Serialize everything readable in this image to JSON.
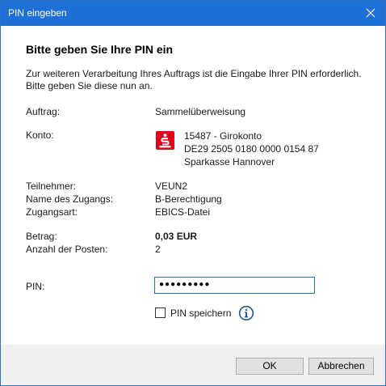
{
  "window": {
    "title": "PIN eingeben"
  },
  "heading": "Bitte geben Sie Ihre PIN ein",
  "intro": {
    "line1": "Zur weiteren Verarbeitung Ihres Auftrags ist die Eingabe Ihrer PIN erforderlich.",
    "line2": "Bitte geben Sie diese nun an."
  },
  "details": {
    "auftrag_label": "Auftrag:",
    "auftrag_value": "Sammelüberweisung",
    "konto_label": "Konto:",
    "konto_line1": "15487 - Girokonto",
    "konto_line2": "DE29 2505 0180 0000 0154 87",
    "konto_line3": "Sparkasse Hannover",
    "teilnehmer_label": "Teilnehmer:",
    "teilnehmer_value": "VEUN2",
    "zugang_label": "Name des Zugangs:",
    "zugang_value": "B-Berechtigung",
    "zugangsart_label": "Zugangsart:",
    "zugangsart_value": "EBICS-Datei",
    "betrag_label": "Betrag:",
    "betrag_value": "0,03 EUR",
    "posten_label": "Anzahl der Posten:",
    "posten_value": "2"
  },
  "pin": {
    "label": "PIN:",
    "masked_value": "●●●●●●●●●",
    "save_label": "PIN speichern",
    "save_checked": false
  },
  "buttons": {
    "ok": "OK",
    "cancel": "Abbrechen"
  },
  "colors": {
    "titlebar": "#1f70d6",
    "bank_logo": "#e2001a",
    "focus_border": "#1f6fd0",
    "info_icon": "#1e5a9e"
  },
  "icons": {
    "close": "close-icon",
    "bank": "sparkasse-logo-icon",
    "info": "info-icon"
  }
}
